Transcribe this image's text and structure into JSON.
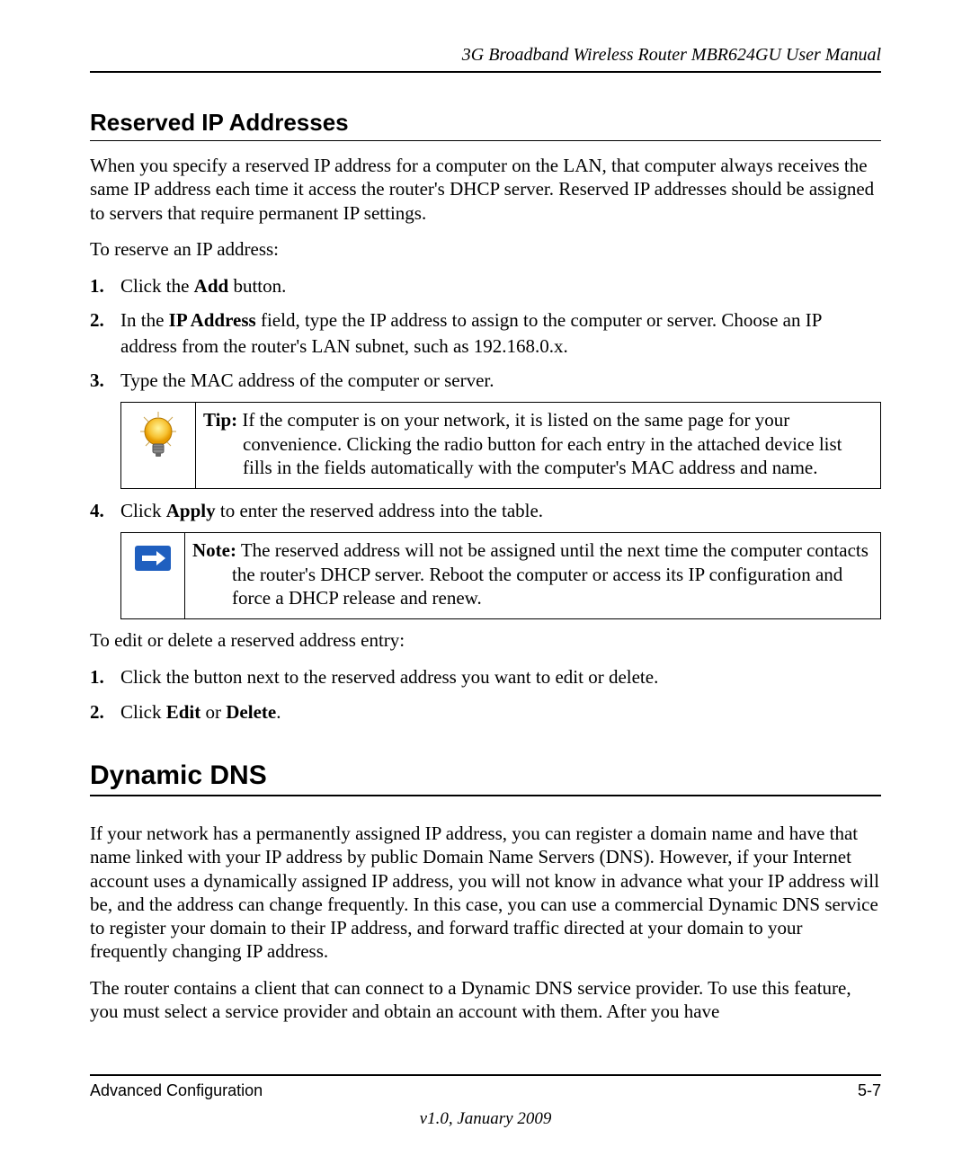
{
  "header": {
    "running_title": "3G Broadband Wireless Router MBR624GU User Manual"
  },
  "section1": {
    "heading": "Reserved IP Addresses",
    "para1": "When you specify a reserved IP address for a computer on the LAN, that computer always receives the same IP address each time it access the router's DHCP server. Reserved IP addresses should be assigned to servers that require permanent IP settings.",
    "para2": "To reserve an IP address:",
    "step1_a": "Click the ",
    "step1_b": "Add",
    "step1_c": " button.",
    "step2_a": "In the ",
    "step2_b": "IP Address",
    "step2_c": " field, type the IP address to assign to the computer or server. Choose an IP address from the router's LAN subnet, such as 192.168.0.x.",
    "step3": "Type the MAC address of the computer or server.",
    "tip_lead": "Tip:",
    "tip_body": " If the computer is on your network, it is listed on the same page for your convenience. Clicking the radio button for each entry in the attached device list fills in the fields automatically with the computer's MAC address and name.",
    "step4_a": "Click ",
    "step4_b": "Apply",
    "step4_c": " to enter the reserved address into the table.",
    "note_lead": "Note:",
    "note_body": " The reserved address will not be assigned until the next time the computer contacts the router's DHCP server. Reboot the computer or access its IP configuration and force a DHCP release and renew.",
    "para3": "To edit or delete a reserved address entry:",
    "ed_step1": "Click the button next to the reserved address you want to edit or delete.",
    "ed_step2_a": "Click ",
    "ed_step2_b": "Edit",
    "ed_step2_c": " or ",
    "ed_step2_d": "Delete",
    "ed_step2_e": "."
  },
  "section2": {
    "heading": "Dynamic DNS",
    "para1": "If your network has a permanently assigned IP address, you can register a domain name and have that name linked with your IP address by public Domain Name Servers (DNS). However, if your Internet account uses a dynamically assigned IP address, you will not know in advance what your IP address will be, and the address can change frequently. In this case, you can use a commercial Dynamic DNS service to register your domain to their IP address, and forward traffic directed at your domain to your frequently changing IP address.",
    "para2": "The router contains a client that can connect to a Dynamic DNS service provider. To use this feature, you must select a service provider and obtain an account with them. After you have"
  },
  "footer": {
    "left": "Advanced Configuration",
    "right": "5-7",
    "version": "v1.0, January 2009"
  },
  "list_numbers": {
    "n1": "1.",
    "n2": "2.",
    "n3": "3.",
    "n4": "4."
  }
}
